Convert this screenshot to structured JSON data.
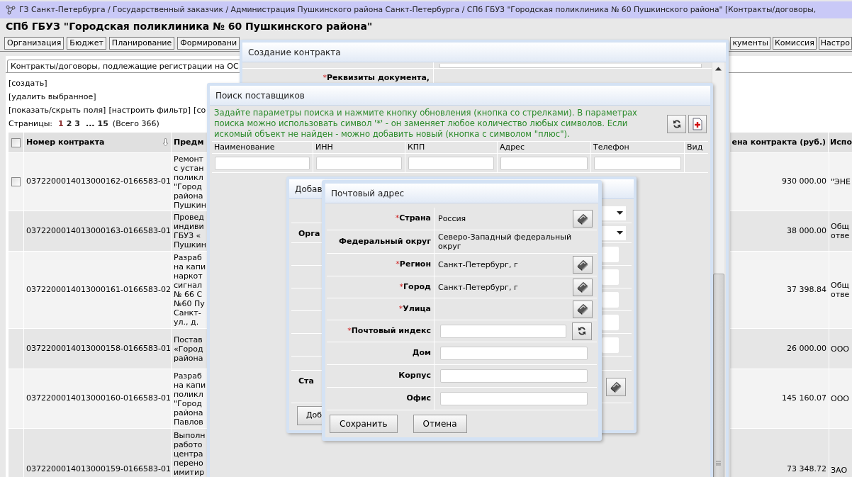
{
  "breadcrumb": "ГЗ Санкт-Петербурга / Государственный заказчик / Администрация Пушкинского района Санкт-Петербурга / СПб ГБУЗ \"Городская поликлиника № 60 Пушкинского района\" [Контракты/договоры,",
  "organization": "СПб ГБУЗ \"Городская поликлиника № 60 Пушкинского района\"",
  "nav_left": [
    "Организация",
    "Бюджет",
    "Планирование",
    "Формировани"
  ],
  "nav_right": [
    "кументы",
    "Комиссия",
    "Настро"
  ],
  "panel_tab": "Контракты/договоры, подлежащие регистрации на ОС",
  "actions": [
    "[создать]",
    "[удалить выбранное]"
  ],
  "action_row": [
    "[показать/скрыть поля]",
    "[настроить фильтр]",
    "[со"
  ],
  "pages": {
    "label": "Страницы:",
    "items": [
      {
        "kind": "page",
        "label": "1",
        "selected": true
      },
      {
        "kind": "page",
        "label": "2",
        "selected": false
      },
      {
        "kind": "page",
        "label": "3",
        "selected": false
      },
      {
        "kind": "gap",
        "label": "..."
      },
      {
        "kind": "page",
        "label": "15",
        "selected": false
      }
    ],
    "total": "(Всего 366)"
  },
  "table": {
    "header_checked": false,
    "columns": [
      "Номер контракта",
      "Предм",
      "ена контракта (руб.)",
      "Испо"
    ],
    "rows": [
      {
        "checked": false,
        "number": "0372200014013000162-0166583-01",
        "subject": [
          "Ремонт",
          "с устан",
          "поликл",
          "\"Город",
          "района",
          "Пушкин"
        ],
        "price": "930 000.00",
        "executor": [
          "\"ЭНЕ"
        ]
      },
      {
        "number": "0372200014013000163-0166583-01",
        "subject": [
          "Провед",
          "индиви",
          "ГБУЗ «",
          "Пушкин"
        ],
        "price": "38 000.00",
        "executor": [
          "Общ",
          "отве"
        ]
      },
      {
        "number": "0372200014013000161-0166583-02",
        "subject": [
          "Разраб",
          "на капи",
          "наркот",
          "сигнал",
          "№ 66 С",
          "№60 Пу",
          "Санкт-",
          "ул., д."
        ],
        "price": "37 398.84",
        "executor": [
          "Общ",
          "отве"
        ]
      },
      {
        "number": "0372200014013000158-0166583-01",
        "subject": [
          "Постав",
          "«Город",
          "района"
        ],
        "price": "26 000.00",
        "executor": [
          "ООО"
        ]
      },
      {
        "number": "0372200014013000160-0166583-01",
        "subject": [
          "Разраб",
          "на капи",
          "поликл",
          "\"Город",
          "района",
          "Павлов"
        ],
        "price": "145 160.07",
        "executor": [
          "ООО"
        ]
      },
      {
        "number": "0372200014013000159-0166583-01",
        "subject": [
          "Выполн",
          "работо",
          "центра",
          "перено",
          "имитир"
        ],
        "price": "73 348.72",
        "executor": [
          "ЗАО"
        ]
      }
    ]
  },
  "contract_window": {
    "title": "Создание контракта",
    "field_mark": "*",
    "field_label": "Реквизиты документа,"
  },
  "supplier_search": {
    "title": "Поиск поставщиков",
    "hint": "Задайте параметры поиска и нажмите кнопку обновления (кнопка со стрелками). В параметрах поиска можно использовать символ '*' - он заменяет любое количество любых символов. Если искомый объект не найден - можно добавить новый (кнопка с символом \"плюс\").",
    "columns": [
      {
        "label": "Наименование",
        "filter": true
      },
      {
        "label": "ИНН",
        "filter": true
      },
      {
        "label": "КПП",
        "filter": true
      },
      {
        "label": "Адрес",
        "filter": true
      },
      {
        "label": "Телефон",
        "filter": true
      },
      {
        "label": "Вид",
        "filter": false
      }
    ]
  },
  "add_window": {
    "title": "Добав",
    "rows": [
      {
        "kind": "select"
      },
      {
        "kind": "select",
        "label": "Орга"
      },
      {
        "kind": "input"
      },
      {
        "kind": "input"
      },
      {
        "kind": "input"
      },
      {
        "kind": "input"
      },
      {
        "kind": "input"
      },
      {
        "kind": "empty"
      },
      {
        "kind": "lookup",
        "label": "Ста"
      }
    ],
    "button": "Доб"
  },
  "address_window": {
    "title": "Почтовый адрес",
    "fields": [
      {
        "mark": "*",
        "label": "Страна",
        "kind": "lookup",
        "value": "Россия"
      },
      {
        "label": "Федеральный округ",
        "kind": "text",
        "value": "Северо-Западный федеральный округ"
      },
      {
        "mark": "*",
        "label": "Регион",
        "kind": "lookup",
        "value": "Санкт-Петербург, г"
      },
      {
        "mark": "*",
        "label": "Город",
        "kind": "lookup",
        "value": "Санкт-Петербург, г"
      },
      {
        "mark": "*",
        "label": "Улица",
        "kind": "lookup"
      },
      {
        "mark": "*",
        "label": "Почтовый индекс",
        "kind": "refresh_input"
      },
      {
        "label": "Дом",
        "kind": "input"
      },
      {
        "label": "Корпус",
        "kind": "input"
      },
      {
        "label": "Офис",
        "kind": "input"
      }
    ],
    "buttons": [
      "Сохранить",
      "Отмена"
    ]
  }
}
